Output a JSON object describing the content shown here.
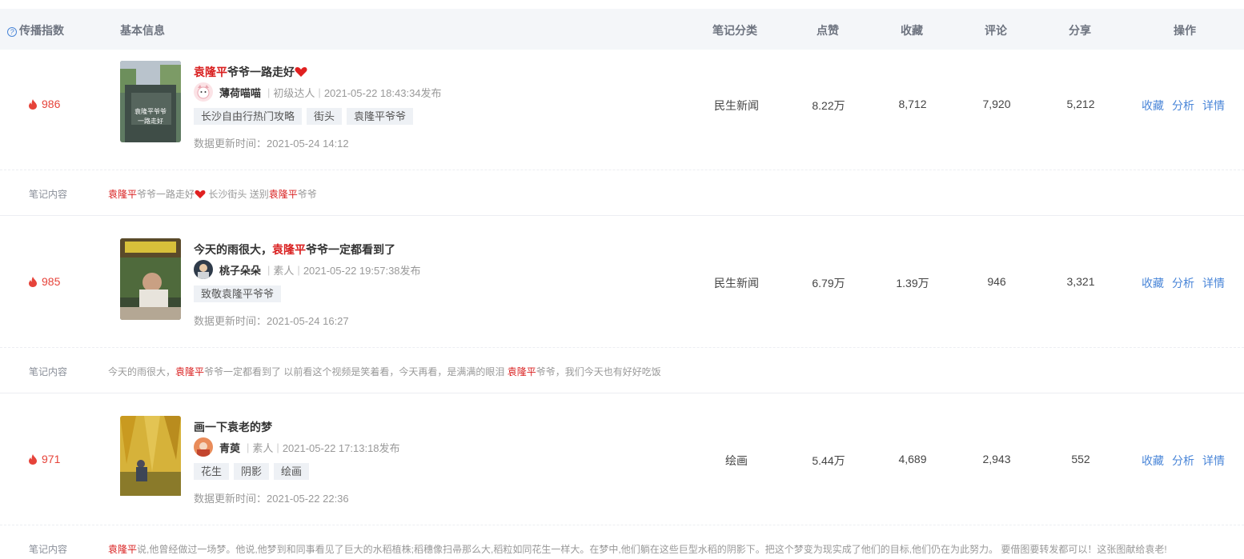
{
  "header": {
    "spread_index": "传播指数",
    "basic_info": "基本信息",
    "category": "笔记分类",
    "likes": "点赞",
    "favorites": "收藏",
    "comments": "评论",
    "shares": "分享",
    "actions": "操作"
  },
  "colors": {
    "accent_blue": "#4a86d8",
    "highlight_red": "#d91f1f",
    "heat_red": "#e6433a",
    "header_bg": "#f4f6f9"
  },
  "actions": {
    "collect": "收藏",
    "analyze": "分析",
    "detail": "详情"
  },
  "content_label": "笔记内容",
  "rows": [
    {
      "heat": "986",
      "title_hl": "袁隆平",
      "title_rest": "爷爷一路走好",
      "title_suffix": "",
      "author": "薄荷喵喵",
      "level": "初级达人",
      "published": "2021-05-22 18:43:34发布",
      "tags": [
        "长沙自由行热门攻略",
        "街头",
        "袁隆平爷爷"
      ],
      "updated": "数据更新时间：2021-05-24 14:12",
      "category": "民生新闻",
      "likes": "8.22万",
      "favorites": "8,712",
      "comments": "7,920",
      "shares": "5,212",
      "content": {
        "p1_hl": "袁隆平",
        "p1": "爷爷一路走好",
        "p2": " 长沙街头 送别",
        "p2_hl": "袁隆平",
        "p3": "爷爷"
      },
      "thumb_text": "袁隆平爷爷一路走好"
    },
    {
      "heat": "985",
      "title_pre": "今天的雨很大，",
      "title_hl": "袁隆平",
      "title_rest": "爷爷一定都看到了",
      "author": "桃子朵朵",
      "level": "素人",
      "published": "2021-05-22 19:57:38发布",
      "tags": [
        "致敬袁隆平爷爷"
      ],
      "updated": "数据更新时间：2021-05-24 16:27",
      "category": "民生新闻",
      "likes": "6.79万",
      "favorites": "1.39万",
      "comments": "946",
      "shares": "3,321",
      "content": {
        "p1": "今天的雨很大，",
        "p1_hl": "袁隆平",
        "p2": "爷爷一定都看到了 以前看这个视频是笑着看，今天再看，是满满的眼泪 ",
        "p2_hl": "袁隆平",
        "p3": "爷爷，我们今天也有好好吃饭"
      }
    },
    {
      "heat": "971",
      "title_rest": "画一下袁老的梦",
      "author": "青萸",
      "level": "素人",
      "published": "2021-05-22 17:13:18发布",
      "tags": [
        "花生",
        "阴影",
        "绘画"
      ],
      "updated": "数据更新时间：2021-05-22 22:36",
      "category": "绘画",
      "likes": "5.44万",
      "favorites": "4,689",
      "comments": "2,943",
      "shares": "552",
      "content": {
        "p1_hl": "袁隆平",
        "p1": "说,他曾经做过一场梦。他说,他梦到和同事看见了巨大的水稻植株;稻穗像扫帚那么大,稻粒如同花生一样大。在梦中,他们躺在这些巨型水稻的阴影下。把这个梦变为现实成了他们的目标,他们仍在为此努力。 要借图要转发都可以！这张图献给袁老!"
      }
    }
  ]
}
